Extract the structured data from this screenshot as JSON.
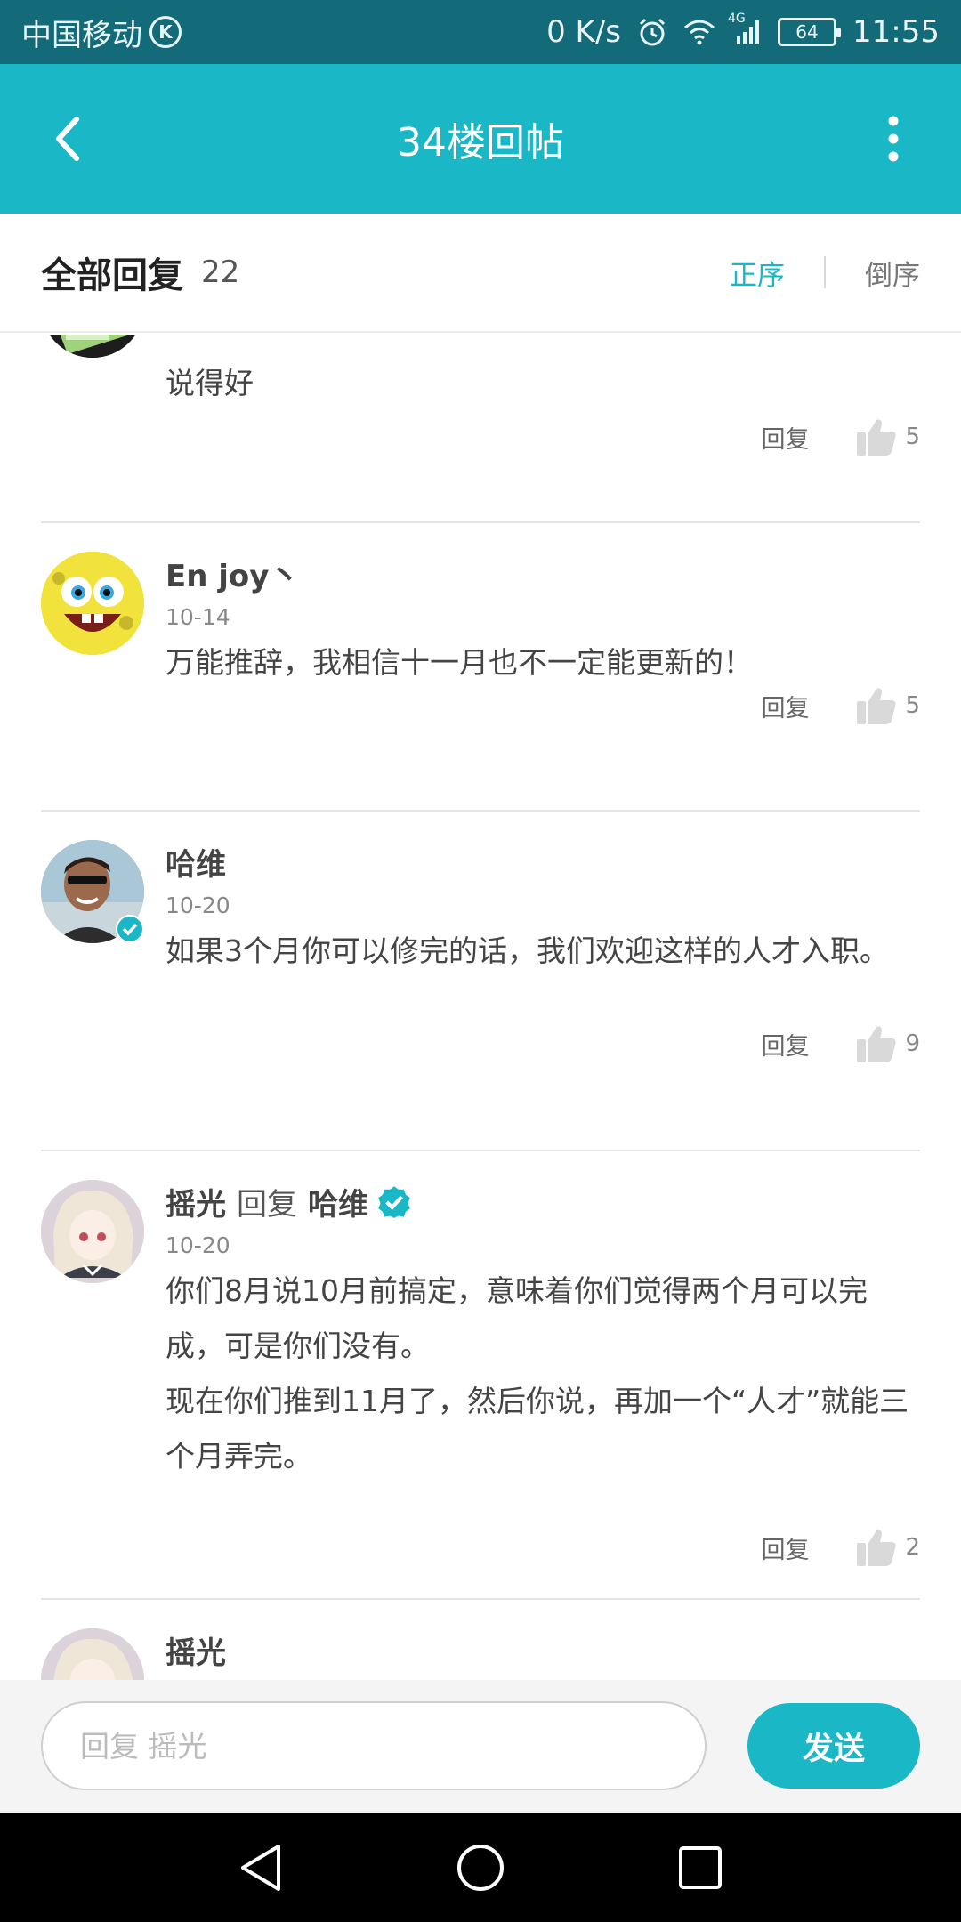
{
  "status_bar": {
    "carrier": "中国移动",
    "carrier_badge": "K",
    "net_speed": "0 K/s",
    "signal_label": "4G",
    "battery": "64",
    "time": "11:55"
  },
  "header": {
    "title": "34楼回帖",
    "back_icon": "back-arrow-icon",
    "more_icon": "more-vertical-icon"
  },
  "section": {
    "title": "全部回复",
    "count": "22",
    "sort_asc": "正序",
    "sort_desc": "倒序",
    "active_sort": "正序"
  },
  "comments": [
    {
      "text": "说得好",
      "reply_label": "回复",
      "likes": "5"
    },
    {
      "name": "En  joy丶",
      "date": "10-14",
      "text": "万能推辞，我相信十一月也不一定能更新的！",
      "reply_label": "回复",
      "likes": "5"
    },
    {
      "name": "哈维",
      "date": "10-20",
      "verified": true,
      "text": "如果3个月你可以修完的话，我们欢迎这样的人才入职。",
      "reply_label": "回复",
      "likes": "9"
    },
    {
      "name": "摇光",
      "reply_word": "回复",
      "reply_to": "哈维",
      "reply_to_verified": true,
      "date": "10-20",
      "text_lines": [
        "你们8月说10月前搞定，意味着你们觉得两个月可以完成，可是你们没有。",
        "现在你们推到11月了，然后你说，再加一个“人才”就能三个月弄完。"
      ],
      "reply_label": "回复",
      "likes": "2"
    },
    {
      "name": "摇光"
    }
  ],
  "reply_bar": {
    "placeholder": "回复 摇光",
    "send_label": "发送"
  },
  "colors": {
    "accent": "#1ab8c6",
    "status_bar": "#136a78"
  }
}
